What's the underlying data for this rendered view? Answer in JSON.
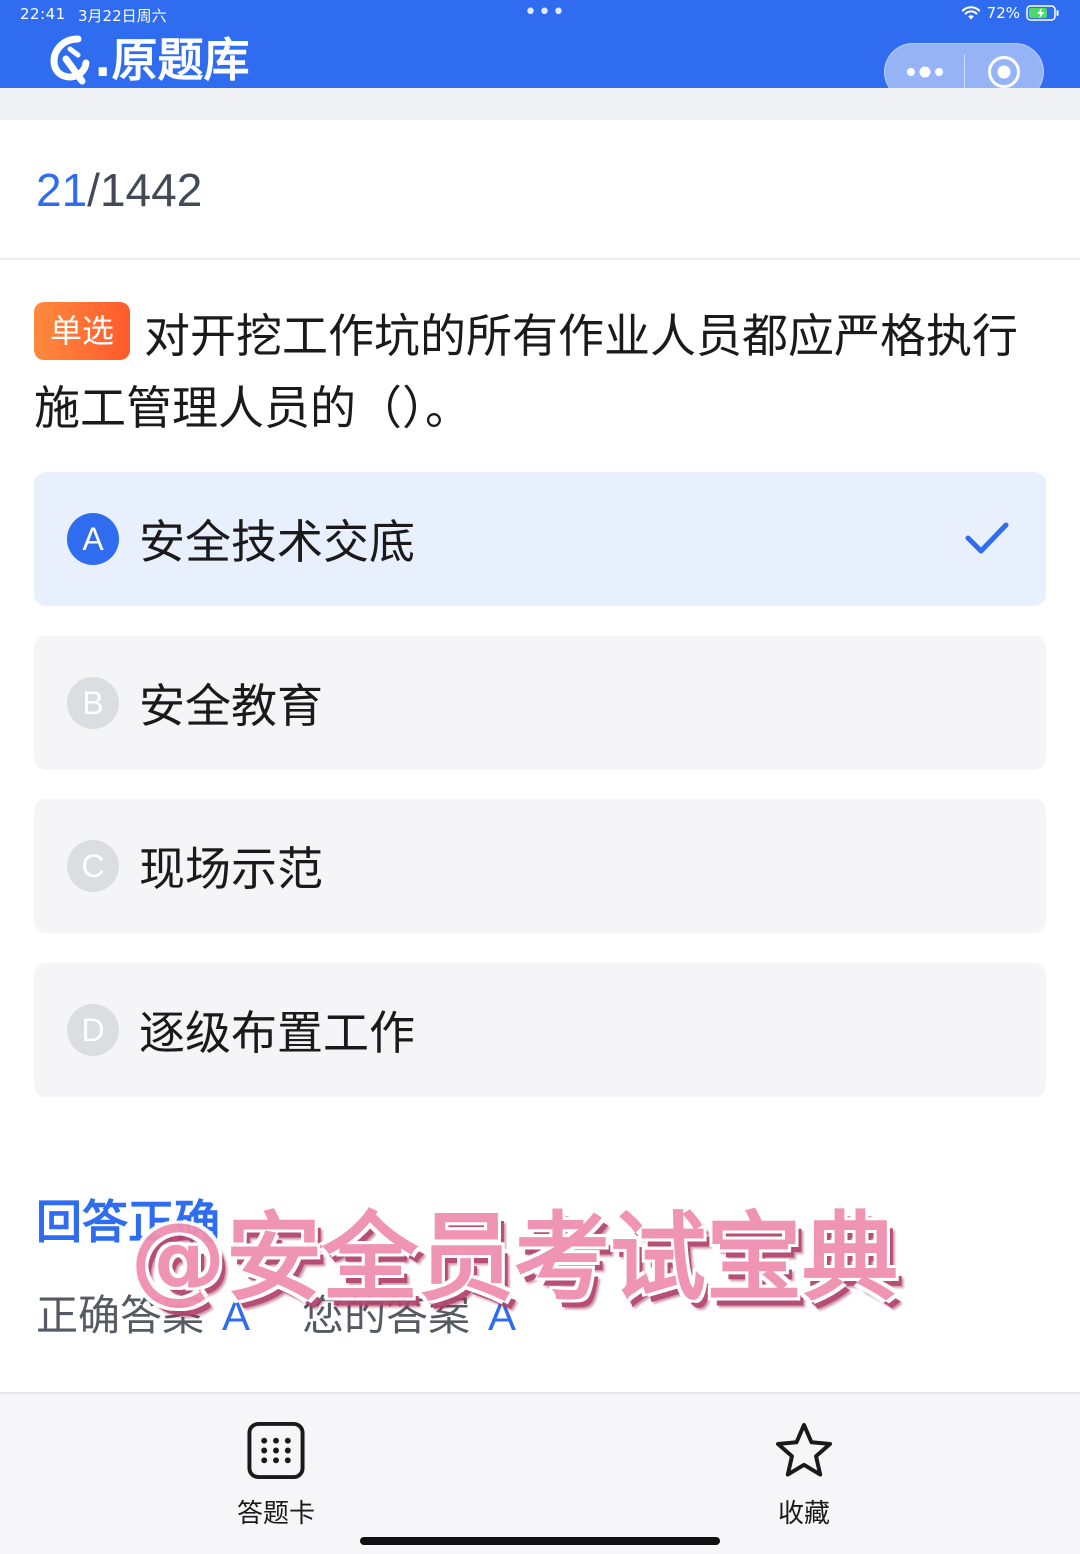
{
  "status_bar": {
    "time": "22:41",
    "date": "3月22日周六",
    "battery": "72%"
  },
  "header": {
    "app_title": ".原题库",
    "logo_icon": "brand-q-icon",
    "capsule_more_icon": "more-dots-icon",
    "capsule_close_icon": "target-close-icon",
    "accent_color": "#2f6cf0"
  },
  "progress": {
    "current": "21",
    "separator": "/",
    "total": "1442"
  },
  "question": {
    "type_badge": "单选",
    "text": "对开挖工作坑的所有作业人员都应严格执行施工管理人员的（）。"
  },
  "options": [
    {
      "letter": "A",
      "text": "安全技术交底",
      "selected": true
    },
    {
      "letter": "B",
      "text": "安全教育",
      "selected": false
    },
    {
      "letter": "C",
      "text": "现场示范",
      "selected": false
    },
    {
      "letter": "D",
      "text": "逐级布置工作",
      "selected": false
    }
  ],
  "result": {
    "title": "回答正确",
    "correct_label": "正确答案",
    "correct_value": "A",
    "your_label": "您的答案",
    "your_value": "A"
  },
  "watermark": {
    "text": "@安全员考试宝典"
  },
  "bottom_nav": {
    "answer_card_label": "答题卡",
    "answer_card_icon": "grid-card-icon",
    "favorite_label": "收藏",
    "favorite_icon": "star-icon"
  }
}
